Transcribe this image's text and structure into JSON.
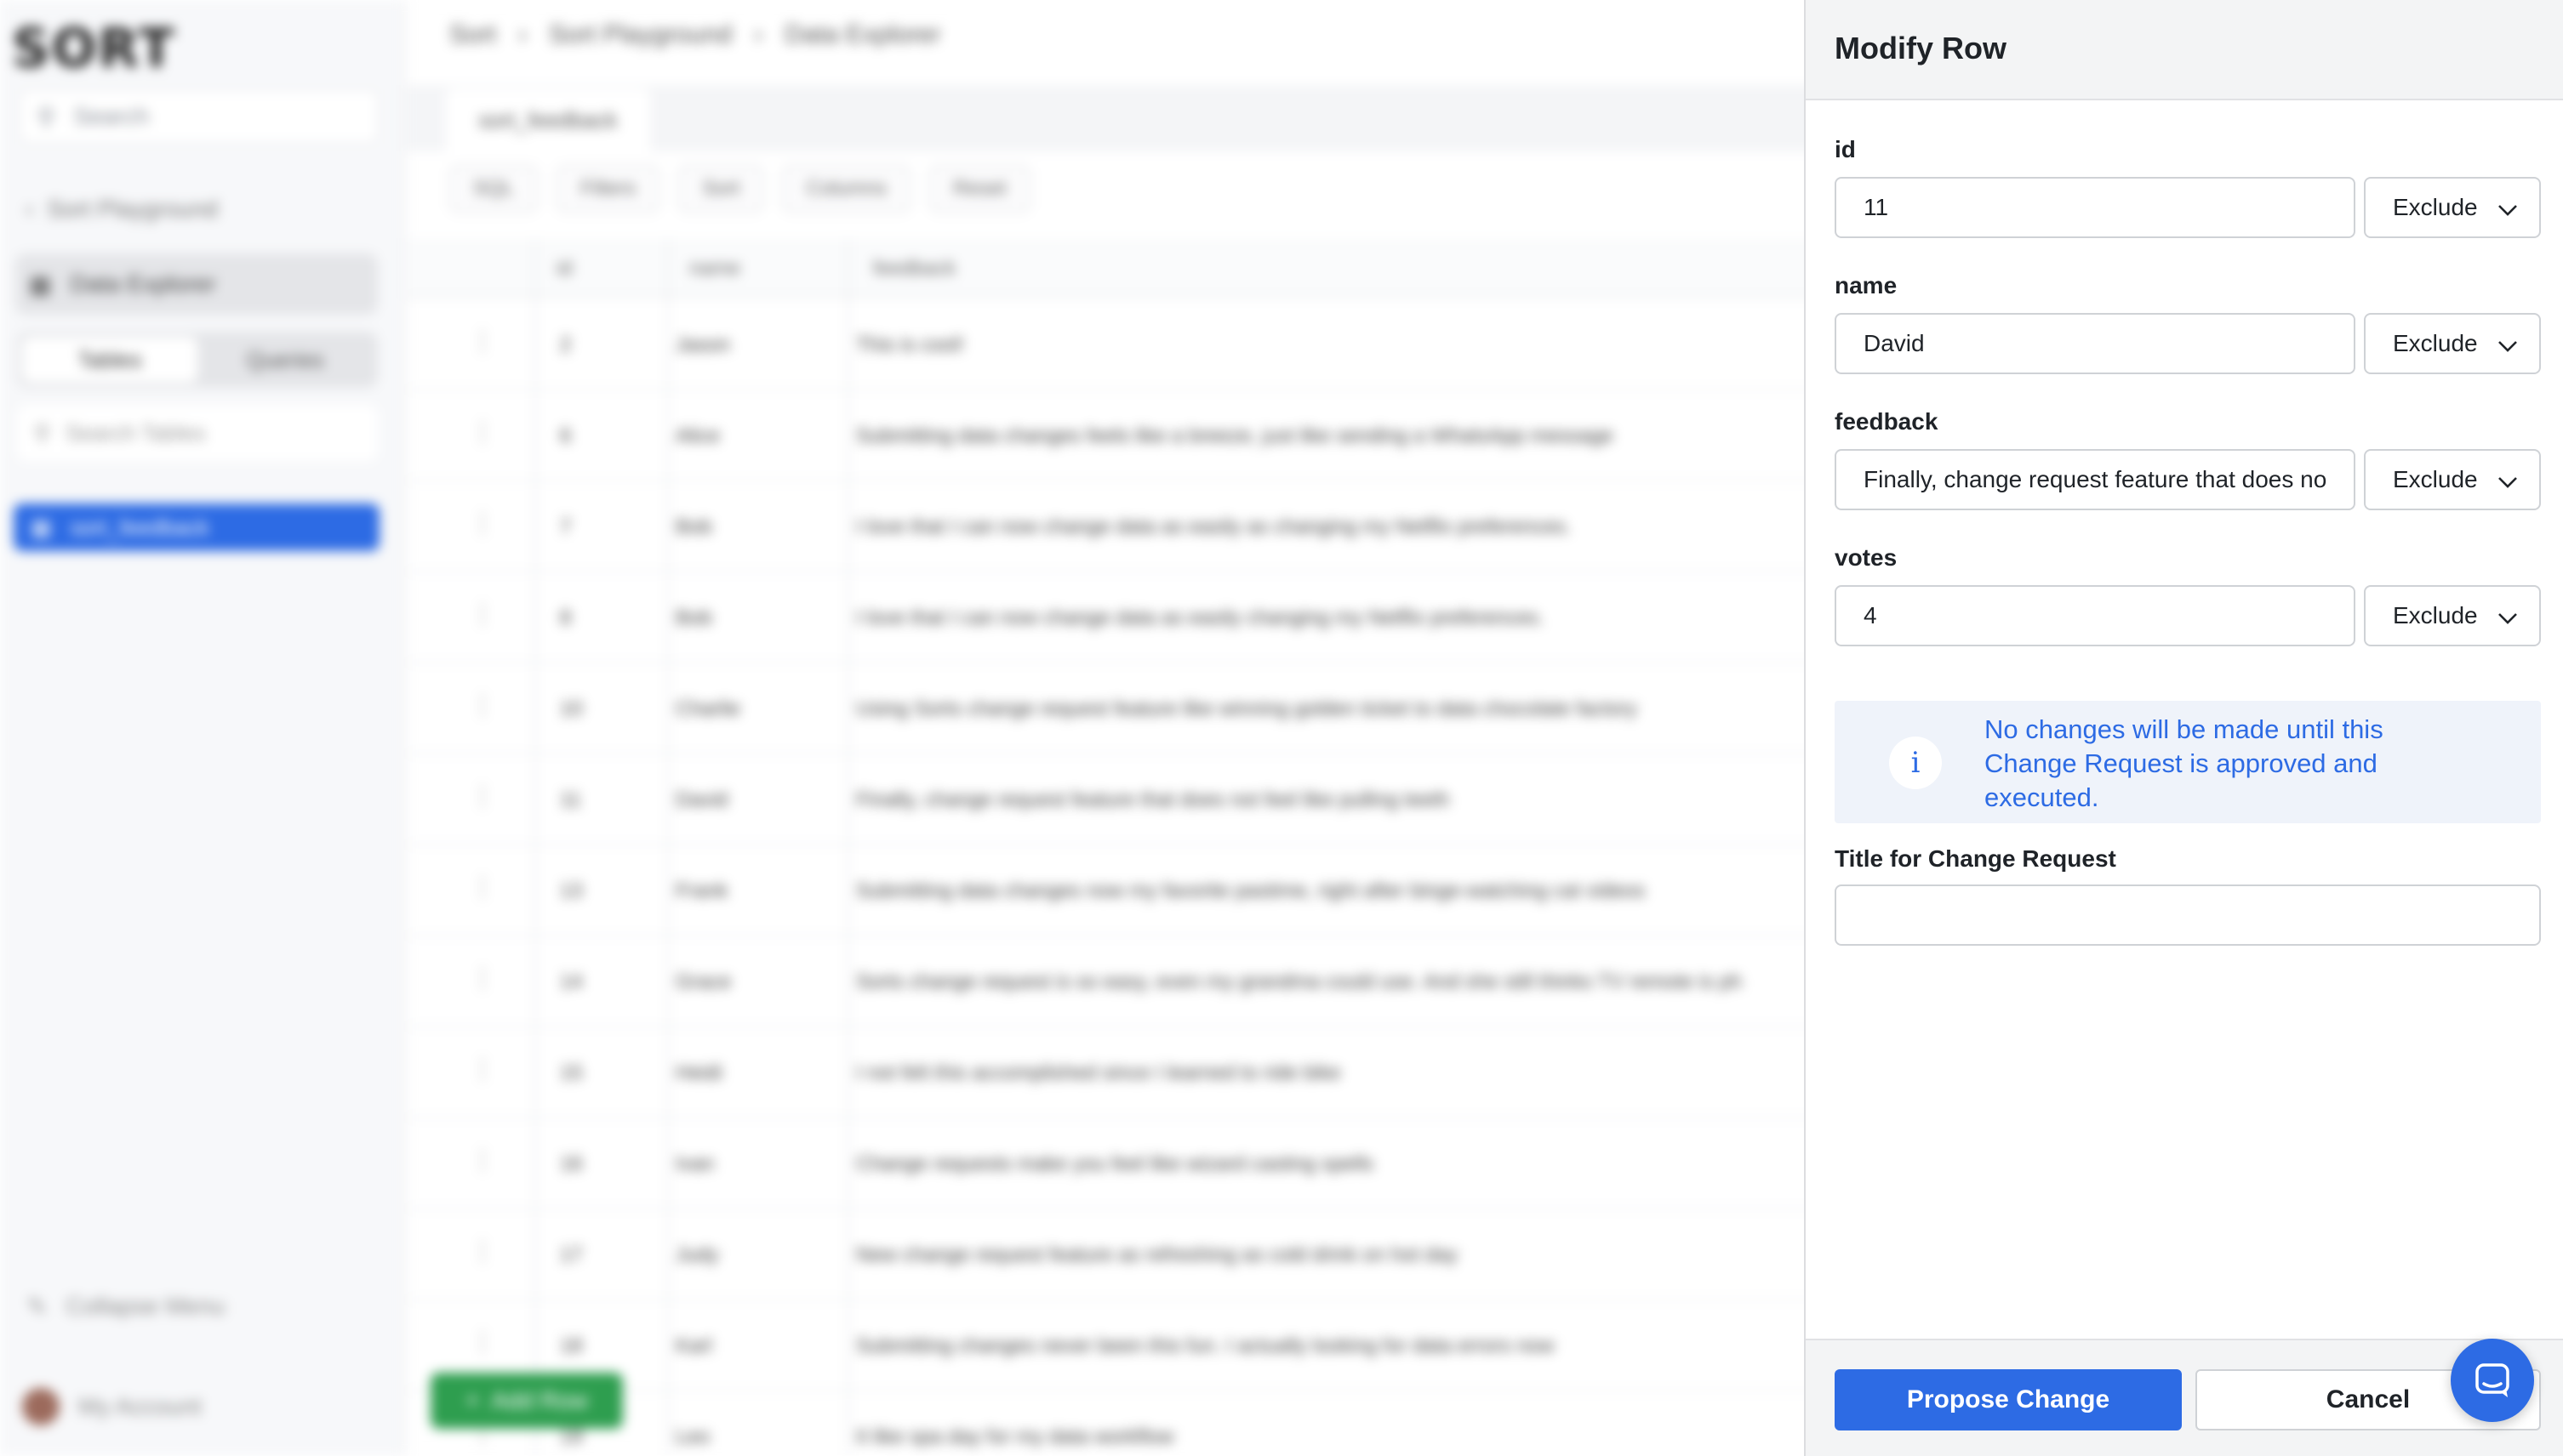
{
  "background": {
    "logo": "SORT",
    "search_placeholder": "Search",
    "back_link": "Sort Playground",
    "nav_active": "Data Explorer",
    "segment": [
      "Tables",
      "Queries"
    ],
    "table_search_placeholder": "Search Tables",
    "active_table": "sort_feedback",
    "collapse_menu": "Collapse Menu",
    "my_account": "My Account",
    "breadcrumbs": [
      "Sort",
      "Sort Playground",
      "Data Explorer"
    ],
    "tab": "sort_feedback",
    "toolbar": [
      "SQL",
      "Filters",
      "Sort",
      "Columns",
      "Reset"
    ],
    "columns": [
      "id",
      "name",
      "feedback"
    ],
    "rows": [
      {
        "id": "2",
        "name": "Jason",
        "feedback": "This is cool!"
      },
      {
        "id": "6",
        "name": "Alice",
        "feedback": "Submitting data changes feels like a breeze, just like sending a WhatsApp message"
      },
      {
        "id": "7",
        "name": "Bob",
        "feedback": "I love that I can now change data as easily as changing my Netflix preferences."
      },
      {
        "id": "8",
        "name": "Bob",
        "feedback": "I love that I can now change data as easily changing my Netflix preferences."
      },
      {
        "id": "10",
        "name": "Charlie",
        "feedback": "Using Sorts change request feature like winning golden ticket to data chocolate factory"
      },
      {
        "id": "11",
        "name": "David",
        "feedback": "Finally, change request feature that does not feel like pulling teeth"
      },
      {
        "id": "13",
        "name": "Frank",
        "feedback": "Submitting data changes now my favorite pastime, right after binge-watching cat videos"
      },
      {
        "id": "14",
        "name": "Grace",
        "feedback": "Sorts change request is so easy, even my grandma could use. And she still thinks TV remote is ph"
      },
      {
        "id": "15",
        "name": "Heidi",
        "feedback": "I not felt this accomplished since I learned to ride bike"
      },
      {
        "id": "16",
        "name": "Ivan",
        "feedback": "Change requests make you feel like wizard casting spells"
      },
      {
        "id": "17",
        "name": "Judy",
        "feedback": "New change request feature as refreshing as cold drink on hot day"
      },
      {
        "id": "18",
        "name": "Karl",
        "feedback": "Submitting changes never been this fun. I actually looking for data errors now"
      },
      {
        "id": "19",
        "name": "Leo",
        "feedback": "It like spa day for my data workflow"
      }
    ],
    "add_row": "Add Row"
  },
  "panel": {
    "title": "Modify Row",
    "fields": [
      {
        "label": "id",
        "value": "11",
        "mode": "Exclude"
      },
      {
        "label": "name",
        "value": "David",
        "mode": "Exclude"
      },
      {
        "label": "feedback",
        "value": "Finally, change request feature that does not feel like pulling teeth",
        "mode": "Exclude"
      },
      {
        "label": "votes",
        "value": "4",
        "mode": "Exclude"
      }
    ],
    "info_icon": "i",
    "info_text": "No changes will be made until this Change Request is approved and executed.",
    "cr_title_label": "Title for Change Request",
    "cr_title_value": "",
    "propose_label": "Propose Change",
    "cancel_label": "Cancel"
  },
  "colors": {
    "accent": "#2d6be4",
    "add_row": "#2e9e4f",
    "info_bg": "#eff3fa"
  }
}
